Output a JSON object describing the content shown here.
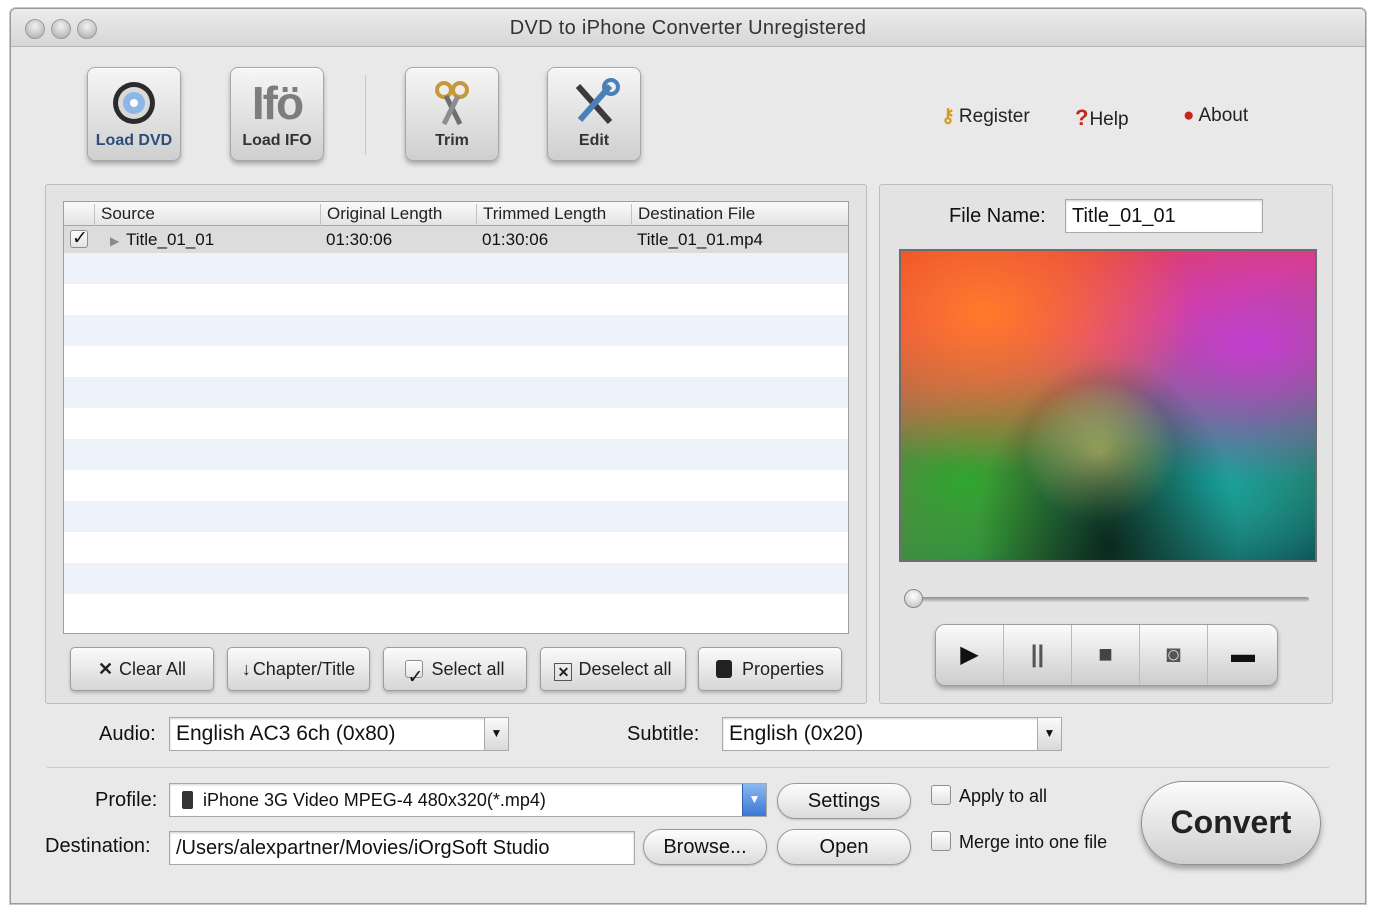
{
  "window": {
    "title": "DVD to iPhone Converter Unregistered"
  },
  "toolbar": {
    "load_dvd": "Load DVD",
    "load_ifo": "Load IFO",
    "ifo_glyph": "Ifö",
    "trim": "Trim",
    "edit": "Edit"
  },
  "top_links": {
    "register": "Register",
    "help": "Help",
    "help_glyph": "?",
    "about": "About"
  },
  "table": {
    "columns": [
      "Source",
      "Original Length",
      "Trimmed Length",
      "Destination File"
    ],
    "rows": [
      {
        "checked": true,
        "source": "Title_01_01",
        "original": "01:30:06",
        "trimmed": "01:30:06",
        "destination": "Title_01_01.mp4"
      }
    ]
  },
  "list_buttons": {
    "clear_all": "Clear All",
    "clear_glyph": "✕",
    "chapter_title": "Chapter/Title",
    "chapter_glyph": "↓",
    "select_all": "Select all",
    "deselect_all": "Deselect all",
    "properties": "Properties"
  },
  "preview": {
    "file_name_label": "File Name:",
    "file_name_value": "Title_01_01"
  },
  "player": {
    "play": "▶",
    "pause": "||",
    "stop": "■",
    "snapshot": "◙",
    "folder": "▬"
  },
  "audio": {
    "label": "Audio:",
    "value": "English AC3 6ch (0x80)"
  },
  "subtitle": {
    "label": "Subtitle:",
    "value": "English (0x20)"
  },
  "profile": {
    "label": "Profile:",
    "value": "iPhone 3G Video MPEG-4 480x320(*.mp4)"
  },
  "destination": {
    "label": "Destination:",
    "value": "/Users/alexpartner/Movies/iOrgSoft Studio"
  },
  "buttons": {
    "settings": "Settings",
    "browse": "Browse...",
    "open": "Open",
    "convert": "Convert"
  },
  "options": {
    "apply_to_all": "Apply to all",
    "merge": "Merge into one file"
  },
  "colors": {
    "row_stripe": "#edf2fb",
    "accent_blue": "#3a78d3",
    "window_bg": "#e9e9e9"
  }
}
